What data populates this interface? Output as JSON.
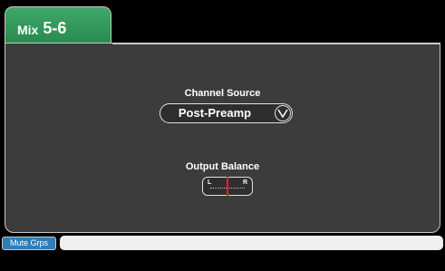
{
  "header": {
    "mix_word": "Mix",
    "mix_number": "5-6",
    "accent": "#2f9a5c"
  },
  "channel_source": {
    "label": "Channel Source",
    "value": "Post-Preamp",
    "dropdown_icon": "chevron-down-icon"
  },
  "output_balance": {
    "label": "Output Balance",
    "left": "L",
    "right": "R",
    "position": 0.5,
    "marker_color": "#ff1f1f"
  },
  "footer": {
    "tab_label": "Mute Grps",
    "tab_color": "#2f7db9"
  }
}
